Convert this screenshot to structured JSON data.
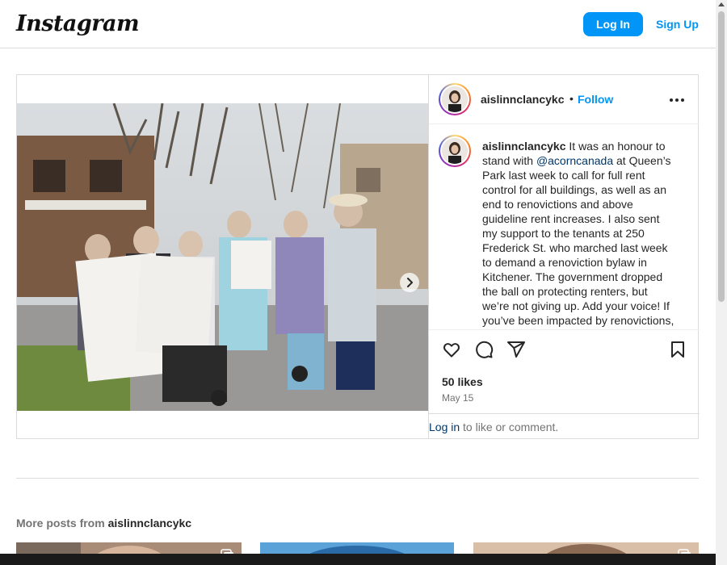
{
  "header": {
    "logo_text": "Instagram",
    "login_label": "Log In",
    "signup_label": "Sign Up"
  },
  "post": {
    "username": "aislinnclancykc",
    "separator": "•",
    "follow_label": "Follow",
    "media": {
      "carousel_slide_count": 3,
      "active_slide": 1
    },
    "caption": {
      "username": "aislinnclancykc",
      "text_before_mention": " It was an honour to stand with ",
      "mention": "@acorncanada",
      "text_after_mention": " at Queen’s Park last week to call for full rent control for all buildings, as well as an end to renovictions and above guideline rent increases. I also sent my support to the tenants at 250 Frederick St. who marched last week to demand a renoviction bylaw in Kitchener. The government dropped the ball on protecting renters, but we’re not giving up. Add your voice! If you’ve been impacted by renovictions, please fill out the ofrm to help"
    },
    "likes": "50 likes",
    "date": "May 15",
    "comment_prompt": {
      "login_link": "Log in",
      "rest": " to like or comment."
    }
  },
  "more_posts": {
    "prefix": "More posts from ",
    "username": "aislinnclancykc"
  },
  "icons": {
    "like": "heart-icon",
    "comment": "comment-icon",
    "share": "share-icon",
    "save": "bookmark-icon",
    "more": "more-options-icon",
    "next": "chevron-right-icon",
    "multi": "carousel-icon"
  },
  "colors": {
    "accent": "#0095f6",
    "text": "#262626",
    "muted": "#737373",
    "border": "#dbdbdb"
  }
}
